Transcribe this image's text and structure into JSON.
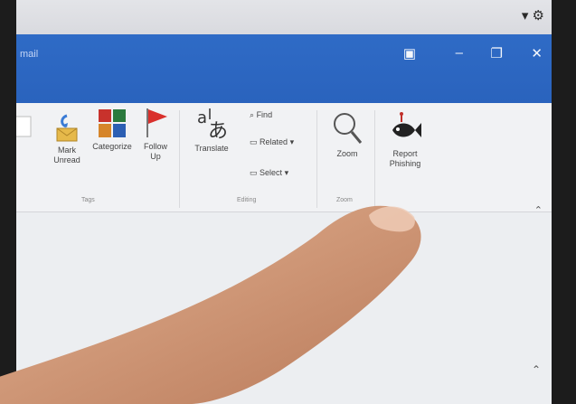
{
  "window": {
    "app_name": "mail"
  },
  "tray": {
    "icons": [
      "chevron-down-icon",
      "gear-icon"
    ]
  },
  "ribbon": {
    "buttons": {
      "mark_unread": "Mark\nUnread",
      "categorize": "Categorize",
      "follow_up": "Follow\nUp",
      "translate": "Translate",
      "find": "Find",
      "related": "Related",
      "select": "Select",
      "zoom": "Zoom",
      "report_phishing": "Report\nPhishing"
    },
    "groups": {
      "tags": "Tags",
      "editing": "Editing",
      "zoom": "Zoom"
    }
  },
  "colors": {
    "titlebar": "#2f6bc6",
    "ribbon": "#f1f2f4",
    "flag": "#d9302c",
    "categorize_red": "#c8322c"
  }
}
